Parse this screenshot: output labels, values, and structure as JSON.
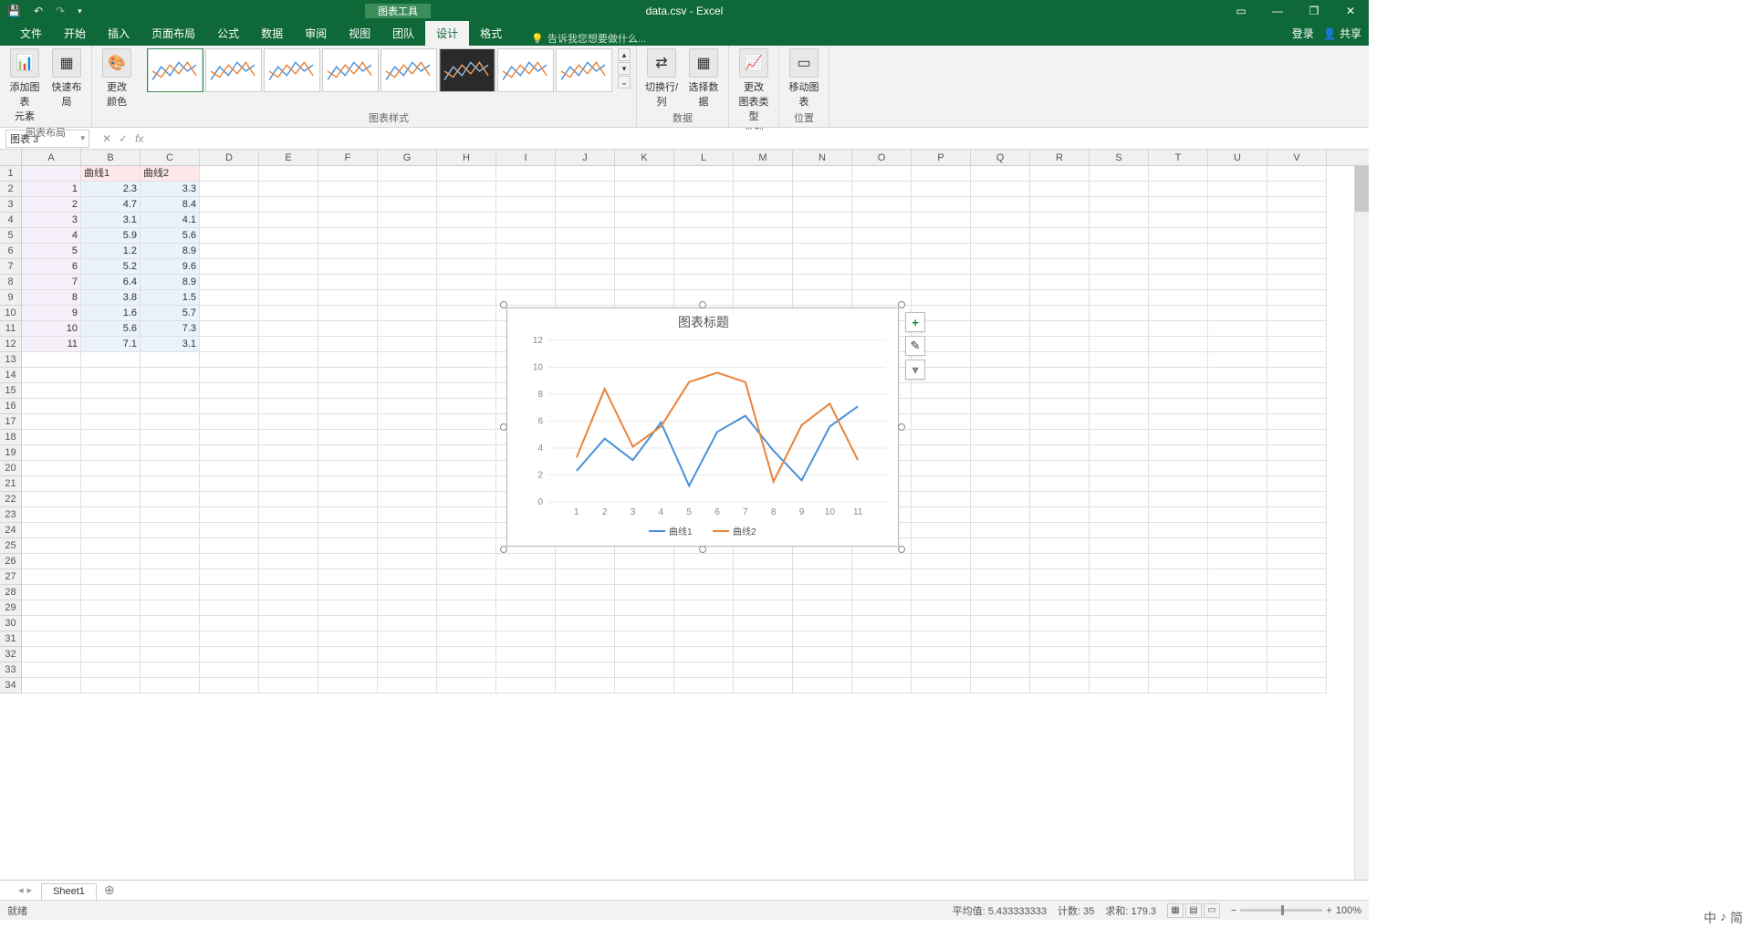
{
  "app": {
    "title": "data.csv - Excel",
    "context_tool": "图表工具"
  },
  "qat": {
    "save": "",
    "undo": "↶",
    "redo": "↷"
  },
  "win": {
    "opts": "▭",
    "min": "—",
    "max": "❐",
    "close": "✕"
  },
  "tabs": {
    "file": "文件",
    "home": "开始",
    "insert": "插入",
    "layout": "页面布局",
    "formulas": "公式",
    "data": "数据",
    "review": "审阅",
    "view": "视图",
    "team": "团队",
    "design": "设计",
    "format": "格式"
  },
  "tellme": "告诉我您想要做什么...",
  "account": {
    "login": "登录",
    "share": "共享"
  },
  "ribbon": {
    "layout_group": "图表布局",
    "add_element": "添加图表\n元素",
    "quick_layout": "快速布局",
    "change_colors": "更改\n颜色",
    "styles_group": "图表样式",
    "data_group": "数据",
    "switch": "切换行/列",
    "select_data": "选择数据",
    "type_group": "类型",
    "change_type": "更改\n图表类型",
    "location_group": "位置",
    "move_chart": "移动图表"
  },
  "namebox": "图表 3",
  "columns": [
    "A",
    "B",
    "C",
    "D",
    "E",
    "F",
    "G",
    "H",
    "I",
    "J",
    "K",
    "L",
    "M",
    "N",
    "O",
    "P",
    "Q",
    "R",
    "S",
    "T",
    "U",
    "V"
  ],
  "headers": {
    "b": "曲线1",
    "c": "曲线2"
  },
  "rows": [
    {
      "a": "1",
      "b": "2.3",
      "c": "3.3"
    },
    {
      "a": "2",
      "b": "4.7",
      "c": "8.4"
    },
    {
      "a": "3",
      "b": "3.1",
      "c": "4.1"
    },
    {
      "a": "4",
      "b": "5.9",
      "c": "5.6"
    },
    {
      "a": "5",
      "b": "1.2",
      "c": "8.9"
    },
    {
      "a": "6",
      "b": "5.2",
      "c": "9.6"
    },
    {
      "a": "7",
      "b": "6.4",
      "c": "8.9"
    },
    {
      "a": "8",
      "b": "3.8",
      "c": "1.5"
    },
    {
      "a": "9",
      "b": "1.6",
      "c": "5.7"
    },
    {
      "a": "10",
      "b": "5.6",
      "c": "7.3"
    },
    {
      "a": "11",
      "b": "7.1",
      "c": "3.1"
    }
  ],
  "chart_data": {
    "type": "line",
    "title": "图表标题",
    "x": [
      1,
      2,
      3,
      4,
      5,
      6,
      7,
      8,
      9,
      10,
      11
    ],
    "series": [
      {
        "name": "曲线1",
        "values": [
          2.3,
          4.7,
          3.1,
          5.9,
          1.2,
          5.2,
          6.4,
          3.8,
          1.6,
          5.6,
          7.1
        ],
        "color": "#4a90d9"
      },
      {
        "name": "曲线2",
        "values": [
          3.3,
          8.4,
          4.1,
          5.6,
          8.9,
          9.6,
          8.9,
          1.5,
          5.7,
          7.3,
          3.1
        ],
        "color": "#e8833a"
      }
    ],
    "ylim": [
      0,
      12
    ],
    "yticks": [
      0,
      2,
      4,
      6,
      8,
      10,
      12
    ]
  },
  "sheet_tab": "Sheet1",
  "status": {
    "ready": "就绪",
    "avg_label": "平均值:",
    "avg": "5.433333333",
    "count_label": "计数:",
    "count": "35",
    "sum_label": "求和:",
    "sum": "179.3",
    "zoom": "100%"
  },
  "ime": {
    "lang": "中",
    "mode": "简"
  },
  "side_btns": {
    "plus": "+",
    "brush": "✎",
    "filter": "▼"
  }
}
